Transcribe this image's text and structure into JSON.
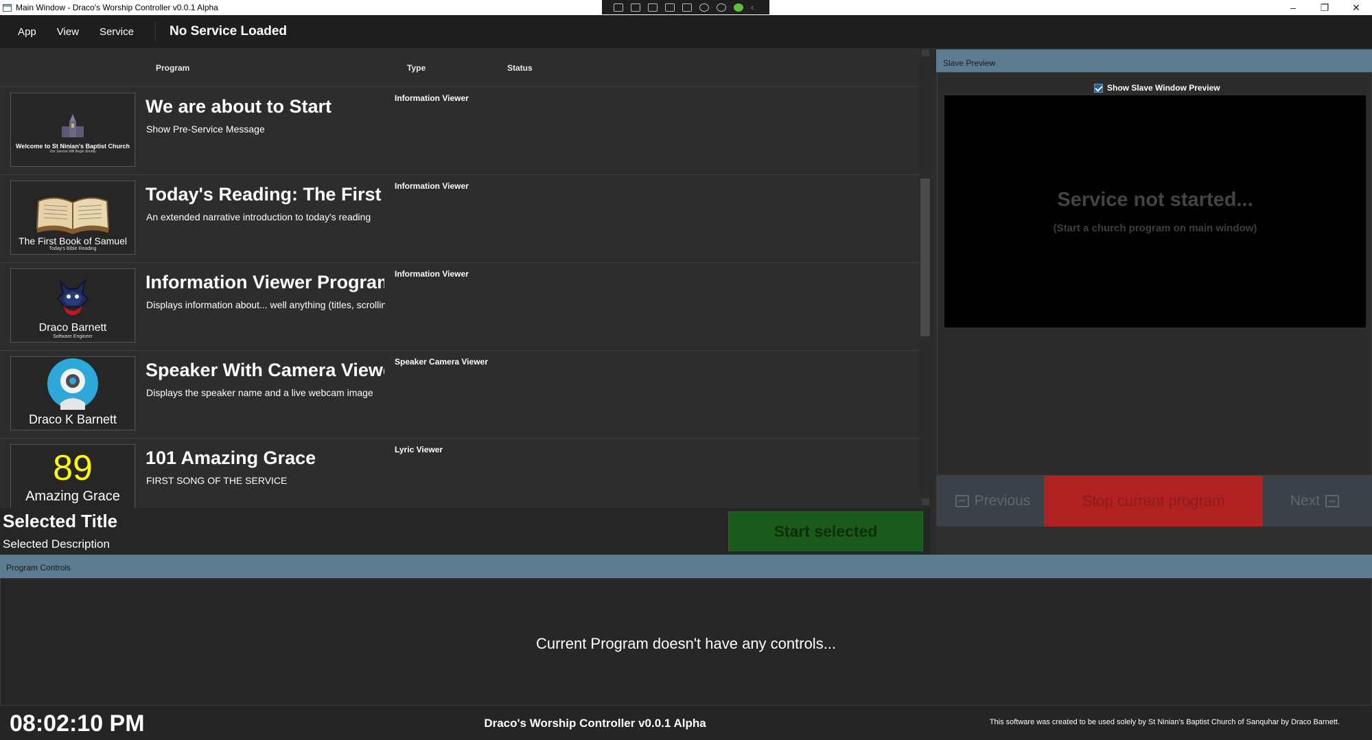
{
  "window": {
    "title": "Main Window - Draco's Worship Controller v0.0.1 Alpha",
    "minimize": "–",
    "restore": "❐",
    "close": "✕"
  },
  "menu": {
    "items": [
      "App",
      "View",
      "Service"
    ],
    "service_title": "No Service Loaded"
  },
  "list": {
    "columns": {
      "program": "Program",
      "type": "Type",
      "status": "Status"
    },
    "rows": [
      {
        "title": "We are about to Start",
        "description": "Show Pre-Service Message",
        "type": "Information Viewer",
        "thumb_main": "Welcome to St Ninian's Baptist Church",
        "thumb_sub": "Our Service Will Begin Shortly",
        "thumb_icon": "church-icon"
      },
      {
        "title": "Today's Reading: The First B",
        "description": "An extended narrative introduction to today's reading",
        "type": "Information Viewer",
        "thumb_main": "The First Book of Samuel",
        "thumb_sub": "Today's Bible Reading",
        "thumb_icon": "open-book-icon"
      },
      {
        "title": "Information Viewer Program",
        "description": "Displays information about... well anything (titles, scrollin",
        "type": "Information Viewer",
        "thumb_main": "Draco Barnett",
        "thumb_sub": "Software Engineer",
        "thumb_icon": "dragon-avatar-icon"
      },
      {
        "title": "Speaker With Camera Viewe",
        "description": "Displays the speaker name and a live webcam image",
        "type": "Speaker Camera Viewer",
        "thumb_main": "Draco K Barnett",
        "thumb_sub": "",
        "thumb_icon": "webcam-icon"
      },
      {
        "title": "101 Amazing Grace",
        "description": "FIRST SONG OF THE SERVICE",
        "type": "Lyric Viewer",
        "thumb_number": "89",
        "thumb_main": "Amazing Grace",
        "thumb_icon": ""
      }
    ]
  },
  "selected": {
    "title": "Selected Title",
    "description": "Selected Description",
    "start_label": "Start selected"
  },
  "slave": {
    "header": "Slave Preview",
    "checkbox_label": "Show Slave Window Preview",
    "not_started": "Service not started...",
    "not_started_sub": "(Start a church program on main window)",
    "previous": "Previous",
    "stop": "Stop current program",
    "next": "Next"
  },
  "controls": {
    "header": "Program Controls",
    "empty_message": "Current Program doesn't have any controls..."
  },
  "status": {
    "clock": "08:02:10 PM",
    "app_name": "Draco's Worship Controller v0.0.1 Alpha",
    "copyright": "This software was created to be used solely by St Ninian's Baptist Church of Sanquhar by Draco Barnett."
  },
  "colors": {
    "panel_header": "#5c7d90",
    "start_button": "#1b5a1b",
    "stop_button": "#b02222",
    "lyric_number": "#ffff00"
  }
}
